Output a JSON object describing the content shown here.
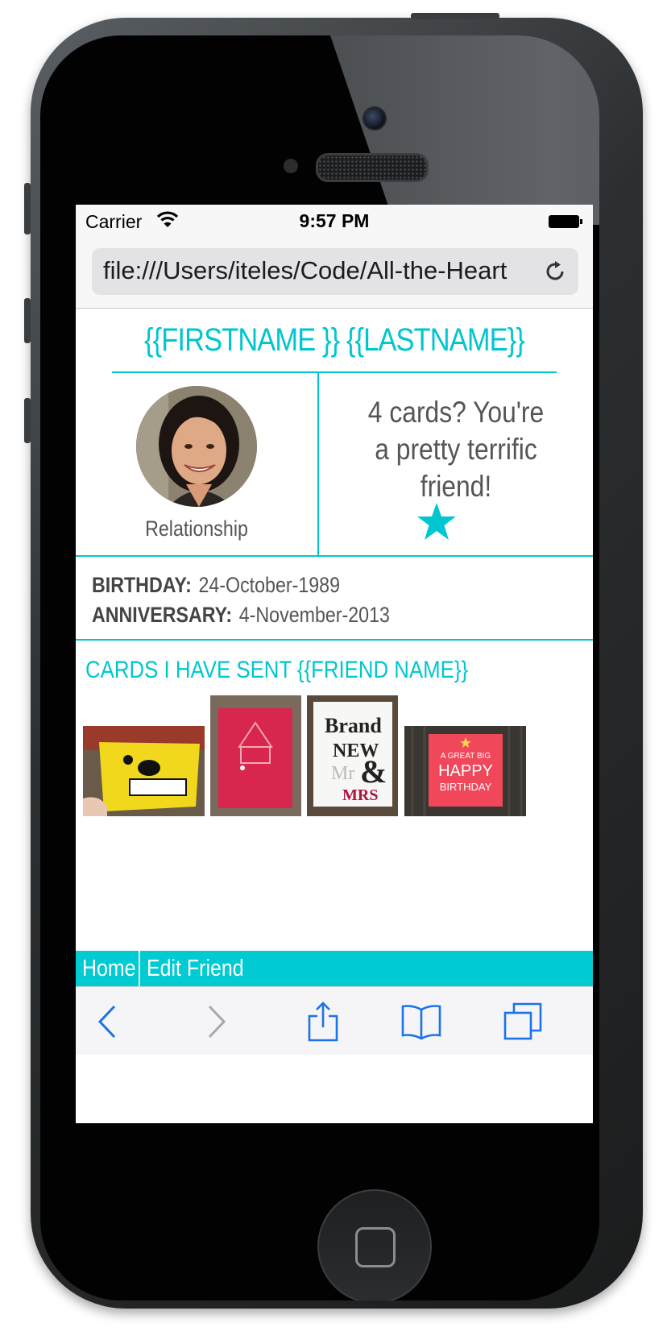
{
  "status_bar": {
    "carrier": "Carrier",
    "time": "9:57 PM"
  },
  "browser": {
    "url": "file:///Users/iteles/Code/All-the-Heart"
  },
  "profile": {
    "name_header": "{{FIRSTNAME }} {{LASTNAME}}",
    "relationship": "Relationship",
    "badge_text": "4 cards? You're a pretty terrific friend!",
    "birthday_label": "BIRTHDAY:",
    "birthday_value": "24-October-1989",
    "anniversary_label": "ANNIVERSARY:",
    "anniversary_value": "4-November-2013"
  },
  "cards": {
    "title": "CARDS I HAVE SENT {{FRIEND NAME}}",
    "items": [
      {
        "name": "yellow-monster-card"
      },
      {
        "name": "red-card"
      },
      {
        "name": "brand-new-mr-mrs-card",
        "text": [
          "Brand",
          "NEW",
          "Mr",
          "&",
          "MRS"
        ]
      },
      {
        "name": "happy-birthday-card",
        "text": [
          "A GREAT BIG",
          "HAPPY",
          "BIRTHDAY"
        ]
      }
    ]
  },
  "web_nav": {
    "home": "Home",
    "edit_friend": "Edit Friend"
  },
  "colors": {
    "accent": "#00c6cf",
    "nav_bg": "#00cad2",
    "ios_blue": "#1a73e8"
  },
  "icons": [
    "wifi-icon",
    "battery-icon",
    "reload-icon",
    "star-icon",
    "back-icon",
    "forward-icon",
    "share-icon",
    "bookmarks-icon",
    "tabs-icon"
  ]
}
